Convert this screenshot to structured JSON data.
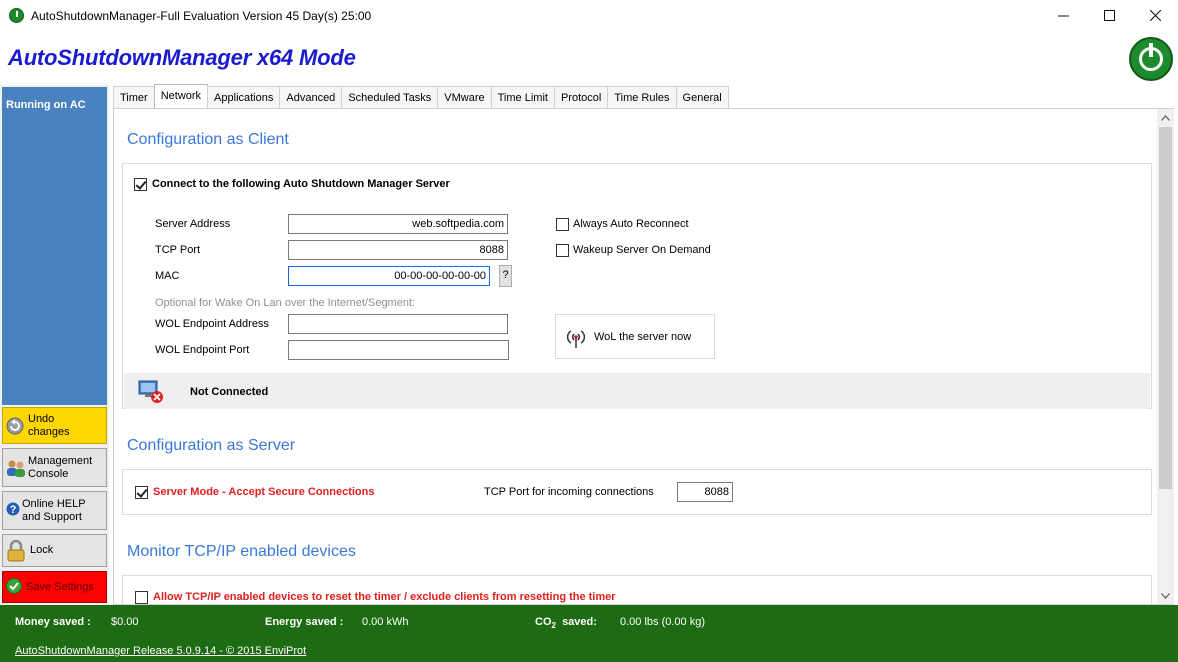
{
  "window": {
    "title": "AutoShutdownManager-Full Evaluation Version 45 Day(s) 25:00",
    "minimize_icon": "minimize-icon",
    "maximize_icon": "maximize-icon",
    "close_icon": "close-icon"
  },
  "header": {
    "headline": "AutoShutdownManager x64 Mode",
    "logo_icon": "power-clock-icon"
  },
  "sidebar": {
    "status": "Running on AC",
    "buttons": [
      {
        "label": "Undo changes",
        "icon": "undo-icon"
      },
      {
        "label": "Management Console",
        "icon": "users-icon"
      },
      {
        "label": "Online HELP and Support",
        "icon": "help-icon"
      },
      {
        "label": "Lock",
        "icon": "padlock-icon"
      },
      {
        "label": "Save Settings",
        "icon": "check-icon"
      }
    ]
  },
  "tabs": [
    {
      "label": "Timer"
    },
    {
      "label": "Network",
      "active": true
    },
    {
      "label": "Applications"
    },
    {
      "label": "Advanced"
    },
    {
      "label": "Scheduled Tasks"
    },
    {
      "label": "VMware"
    },
    {
      "label": "Time Limit"
    },
    {
      "label": "Protocol"
    },
    {
      "label": "Time Rules"
    },
    {
      "label": "General"
    }
  ],
  "client": {
    "section_title": "Configuration as Client",
    "connect_label": "Connect to the  following  Auto Shutdown Manager Server",
    "connect_checked": true,
    "server_address_label": "Server Address",
    "server_address_value": "web.softpedia.com",
    "tcp_port_label": "TCP Port",
    "tcp_port_value": "8088",
    "mac_label": "MAC",
    "mac_value": "00-00-00-00-00-00",
    "mac_help": "?",
    "always_reconnect_label": "Always Auto Reconnect",
    "always_reconnect_checked": false,
    "wakeup_label": "Wakeup Server On Demand",
    "wakeup_checked": false,
    "optional_note": "Optional for Wake On Lan  over the Internet/Segment:",
    "wol_address_label": "WOL Endpoint Address",
    "wol_address_value": "",
    "wol_port_label": "WOL Endpoint Port",
    "wol_port_value": "",
    "wol_button": "WoL the server now",
    "status": "Not Connected"
  },
  "server": {
    "section_title": "Configuration as Server",
    "mode_label": "Server Mode - Accept Secure Connections",
    "mode_checked": true,
    "port_label": "TCP Port for incoming connections",
    "port_value": "8088"
  },
  "monitor": {
    "section_title": "Monitor TCP/IP enabled devices",
    "allow_label": "Allow TCP/IP enabled devices to reset the timer / exclude clients from resetting the timer",
    "allow_checked": false
  },
  "footer": {
    "money_label": "Money saved :",
    "money_value": "$0.00",
    "energy_label": "Energy saved :",
    "energy_value": "0.00 kWh",
    "co2_label_prefix": "CO",
    "co2_label_sub": "2",
    "co2_label_suffix": "  saved:",
    "co2_value": "0.00 lbs  (0.00 kg)",
    "release": "AutoShutdownManager Release 5.0.9.14  - © 2015 EnviProt"
  },
  "colors": {
    "accent_blue": "#3a78d8",
    "headline_blue": "#1a1ad0",
    "footer_green": "#1d6b12",
    "sidebar_blue": "#4a82c0",
    "undo_yellow": "#ffd700",
    "save_red": "#ff0000",
    "label_red": "#e02020"
  }
}
